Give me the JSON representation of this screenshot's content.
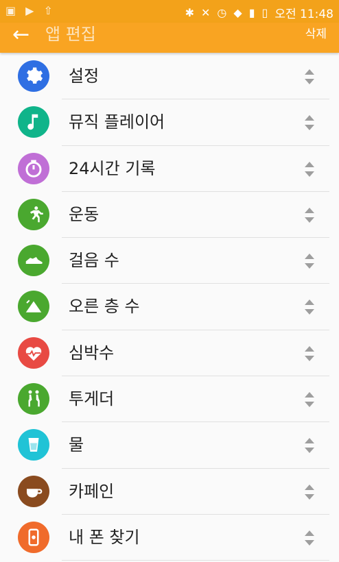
{
  "status": {
    "time": "오전 11:48"
  },
  "appbar": {
    "title": "앱 편집",
    "action": "삭제"
  },
  "items": [
    {
      "label": "설정",
      "icon": "gear-icon",
      "color": "#2f6fe3"
    },
    {
      "label": "뮤직 플레이어",
      "icon": "music-note-icon",
      "color": "#10b48a"
    },
    {
      "label": "24시간 기록",
      "icon": "timer-icon",
      "color": "#c06fd6"
    },
    {
      "label": "운동",
      "icon": "running-icon",
      "color": "#4aa82f"
    },
    {
      "label": "걸음 수",
      "icon": "shoe-icon",
      "color": "#4aa82f"
    },
    {
      "label": "오른 층 수",
      "icon": "mountain-icon",
      "color": "#4aa82f"
    },
    {
      "label": "심박수",
      "icon": "heart-icon",
      "color": "#e84a43"
    },
    {
      "label": "투게더",
      "icon": "walking-people-icon",
      "color": "#4aa82f"
    },
    {
      "label": "물",
      "icon": "water-cup-icon",
      "color": "#20c3d6"
    },
    {
      "label": "카페인",
      "icon": "coffee-cup-icon",
      "color": "#8a4b1f"
    },
    {
      "label": "내 폰 찾기",
      "icon": "phone-icon",
      "color": "#f06b2b"
    }
  ]
}
